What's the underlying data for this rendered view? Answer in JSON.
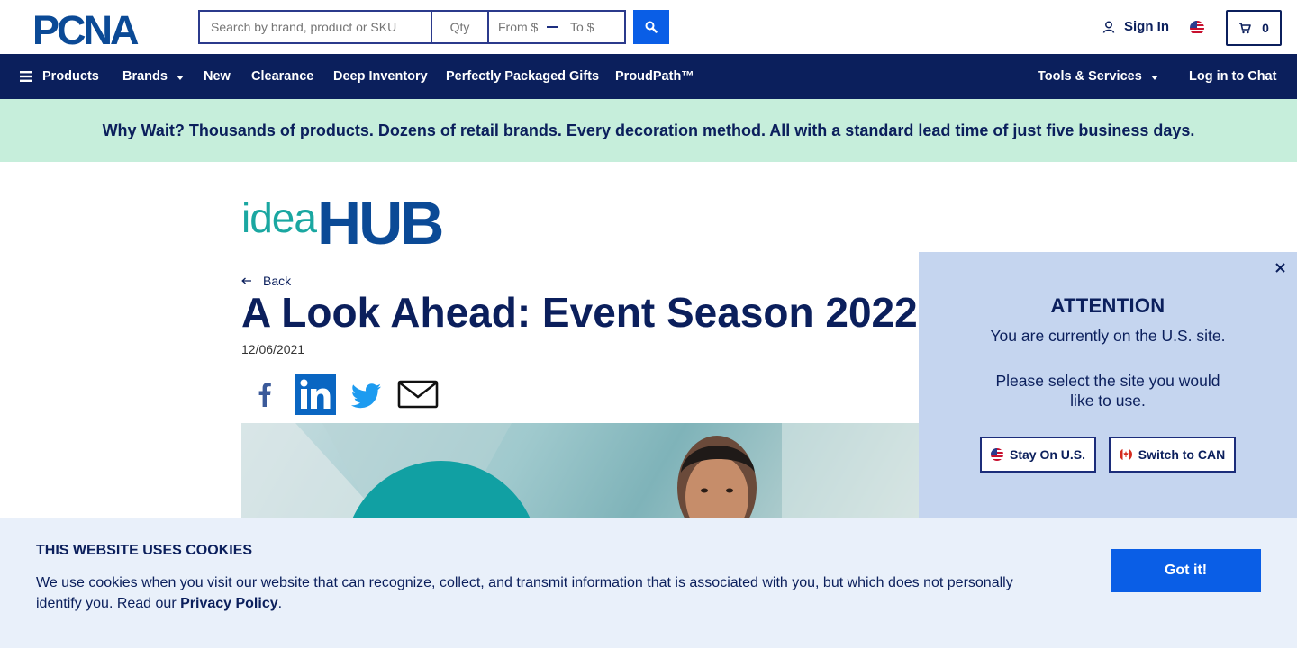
{
  "header": {
    "logo_text": "PCNA",
    "search": {
      "placeholder": "Search by brand, product or SKU",
      "value": ""
    },
    "qty": {
      "placeholder": "Qty"
    },
    "price_from": {
      "placeholder": "From $"
    },
    "price_to": {
      "placeholder": "To $"
    },
    "signin_label": "Sign In",
    "cart_count": "0"
  },
  "nav": {
    "items": [
      {
        "label": "Products"
      },
      {
        "label": "Brands"
      },
      {
        "label": "New"
      },
      {
        "label": "Clearance"
      },
      {
        "label": "Deep Inventory"
      },
      {
        "label": "Perfectly Packaged Gifts"
      },
      {
        "label": "ProudPath™"
      }
    ],
    "tools_label": "Tools & Services",
    "chat_label": "Log in to Chat"
  },
  "promo": {
    "text": "Why Wait? Thousands of products. Dozens of retail brands. Every decoration method. All with a standard lead time of just five business days."
  },
  "article": {
    "brand_light": "idea",
    "brand_bold": "HUB",
    "back_label": "Back",
    "title": "A Look Ahead: Event Season 2022",
    "date": "12/06/2021",
    "share_icons": [
      "facebook-icon",
      "linkedin-icon",
      "twitter-icon",
      "email-icon"
    ]
  },
  "attention": {
    "title": "ATTENTION",
    "line1": "You are currently on the U.S. site.",
    "line2": "Please select the site you would like to use.",
    "stay_label": "Stay On U.S.",
    "switch_label": "Switch to CAN"
  },
  "cookie": {
    "title": "THIS WEBSITE USES COOKIES",
    "text": "We use cookies when you visit our website that can recognize, collect, and transmit information that is associated with you, but which does not personally identify you. Read our",
    "link_label": "Privacy Policy",
    "suffix": ".",
    "button_label": "Got it!"
  },
  "colors": {
    "navy": "#0b1f5c",
    "brand_blue": "#0a5ee6",
    "promo_bg": "#c6eedb",
    "teal": "#1aa7a1",
    "modal_bg": "#c5d5ef",
    "cookie_bg": "#e9f0fa"
  }
}
